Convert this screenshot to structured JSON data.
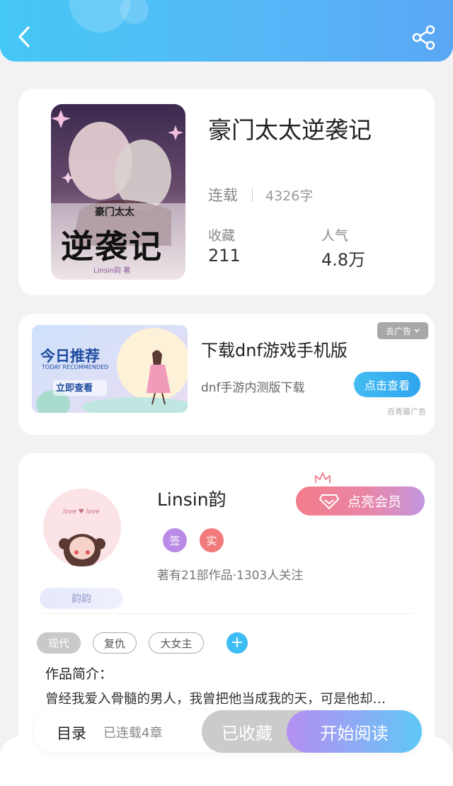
{
  "header": {
    "back_icon": "chevron-left-icon",
    "share_icon": "share-icon"
  },
  "book": {
    "title": "豪门太太逆袭记",
    "cover_title_small": "豪门太太",
    "cover_title_big": "逆袭记",
    "cover_author": "Linsin韵 著",
    "status": "连载",
    "word_count": "4326字",
    "favorites_label": "收藏",
    "favorites_value": "211",
    "popularity_label": "人气",
    "popularity_value": "4.8万"
  },
  "ad": {
    "image_title": "今日推荐",
    "image_subtitle": "TODAY RECOMMENDED",
    "image_button": "立即查看",
    "title": "下载dnf游戏手机版",
    "subtitle": "dnf手游内测版下载",
    "button": "点击查看",
    "remove_label": "去广告",
    "source": "百青藤广告"
  },
  "author": {
    "name": "Linsin韵",
    "nickname_badge": "韵韵",
    "vip_button": "点亮会员",
    "badge_sign": "签",
    "badge_real": "实",
    "stats": "著有21部作品·1303人关注",
    "avatar_text": "love ♥ love",
    "tags": [
      "现代",
      "复仇",
      "大女主"
    ],
    "intro_label": "作品简介：",
    "intro_text": "曾经我爱入骨髓的男人，我曾把他当成我的天，可是他却…"
  },
  "bottom": {
    "toc": "目录",
    "chapters": "已连载4章",
    "collected": "已收藏",
    "read": "开始阅读"
  },
  "colors": {
    "header_start": "#45c8f6",
    "accent_blue": "#3cbef5",
    "vip_pink": "#f47c8a",
    "vip_purple": "#c396e0",
    "badge_sign": "#b98be6",
    "badge_real": "#f27a7a"
  }
}
